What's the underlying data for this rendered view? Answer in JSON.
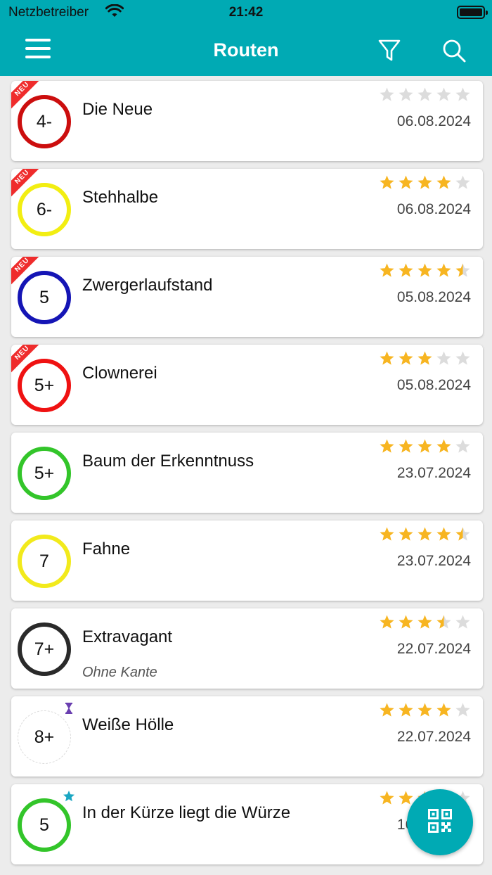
{
  "status": {
    "carrier": "Netzbetreiber",
    "time": "21:42"
  },
  "header": {
    "title": "Routen"
  },
  "colors": {
    "brand": "#00aab4",
    "star_filled": "#f7b521",
    "star_empty": "#dcdcdc",
    "new_ribbon": "#ef2c2c"
  },
  "routes": [
    {
      "name": "Die Neue",
      "grade": "4-",
      "color": "#cc0e0e",
      "rating": 0,
      "date": "06.08.2024",
      "is_new": true,
      "new_label": "NEU"
    },
    {
      "name": "Stehhalbe",
      "grade": "6-",
      "color": "#f2ee12",
      "rating": 4,
      "date": "06.08.2024",
      "is_new": true,
      "new_label": "NEU"
    },
    {
      "name": "Zwergerlaufstand",
      "grade": "5",
      "color": "#1515b5",
      "rating": 4.5,
      "date": "05.08.2024",
      "is_new": true,
      "new_label": "NEU"
    },
    {
      "name": "Clownerei",
      "grade": "5+",
      "color": "#ef1212",
      "rating": 3,
      "date": "05.08.2024",
      "is_new": true,
      "new_label": "NEU"
    },
    {
      "name": "Baum der Erkenntnuss",
      "grade": "5+",
      "color": "#33c52a",
      "rating": 4,
      "date": "23.07.2024"
    },
    {
      "name": "Fahne",
      "grade": "7",
      "color": "#f2ea1c",
      "rating": 4.5,
      "date": "23.07.2024"
    },
    {
      "name": "Extravagant",
      "grade": "7+",
      "color": "#2a2a2a",
      "rating": 3.5,
      "date": "22.07.2024",
      "note": "Ohne Kante"
    },
    {
      "name": "Weiße Hölle",
      "grade": "8+",
      "color": "#ffffff",
      "rating": 4,
      "date": "22.07.2024",
      "badge_icon": "hourglass-icon",
      "badge_color": "#6a3fb0"
    },
    {
      "name": "In der Kürze liegt die Würze",
      "grade": "5",
      "color": "#33c52a",
      "rating": 2.5,
      "date": "16.07.2024",
      "badge_icon": "star-badge-icon",
      "badge_color": "#1aa6c2"
    }
  ],
  "fab": {
    "icon": "qr-code-icon"
  }
}
